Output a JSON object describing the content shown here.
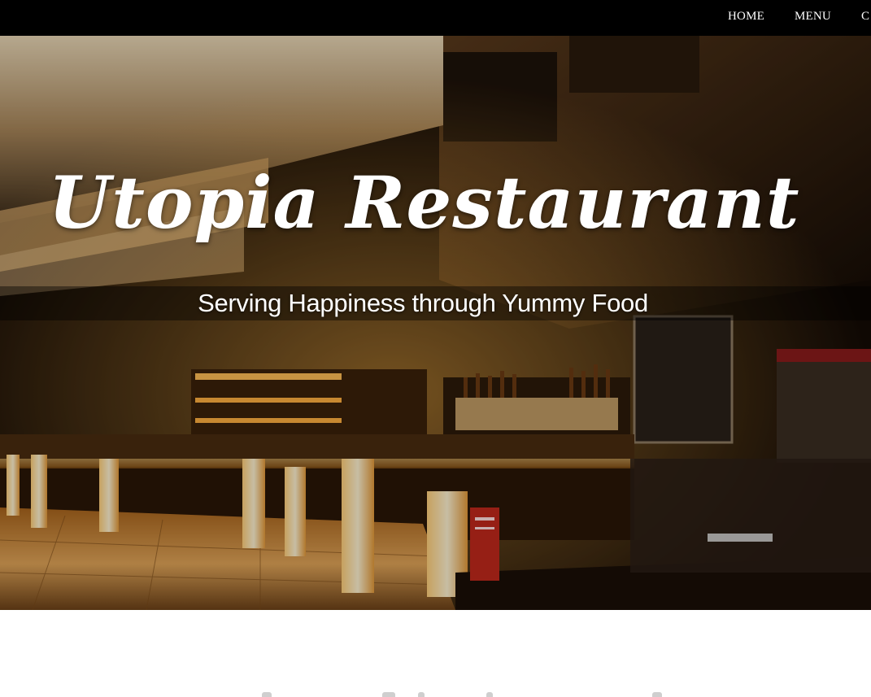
{
  "nav": {
    "items": [
      {
        "label": "HOME"
      },
      {
        "label": "MENU"
      },
      {
        "label": "C"
      }
    ]
  },
  "hero": {
    "title": "Utopia Restaurant",
    "tagline": "Serving Happiness through Yummy Food"
  },
  "colors": {
    "topbar": "#000000",
    "nav_text": "#ffffff",
    "hero_text": "#ffffff",
    "page_background": "#ffffff",
    "warm_light": "#f2b04a"
  }
}
